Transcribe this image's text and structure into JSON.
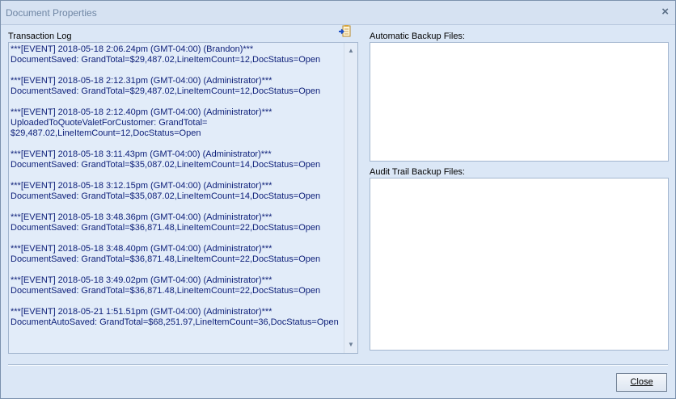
{
  "window": {
    "title": "Document Properties",
    "close_glyph": "×"
  },
  "transaction_log": {
    "label": "Transaction Log",
    "export_icon": "export-to-document-icon",
    "entries": [
      "***[EVENT] 2018-05-18 2:06.24pm (GMT-04:00) (Brandon)***\nDocumentSaved: GrandTotal=$29,487.02,LineItemCount=12,DocStatus=Open",
      "***[EVENT] 2018-05-18 2:12.31pm (GMT-04:00) (Administrator)***\nDocumentSaved: GrandTotal=$29,487.02,LineItemCount=12,DocStatus=Open",
      "***[EVENT] 2018-05-18 2:12.40pm (GMT-04:00) (Administrator)***\nUploadedToQuoteValetForCustomer: GrandTotal=\n$29,487.02,LineItemCount=12,DocStatus=Open",
      "***[EVENT] 2018-05-18 3:11.43pm (GMT-04:00) (Administrator)***\nDocumentSaved: GrandTotal=$35,087.02,LineItemCount=14,DocStatus=Open",
      "***[EVENT] 2018-05-18 3:12.15pm (GMT-04:00) (Administrator)***\nDocumentSaved: GrandTotal=$35,087.02,LineItemCount=14,DocStatus=Open",
      "***[EVENT] 2018-05-18 3:48.36pm (GMT-04:00) (Administrator)***\nDocumentSaved: GrandTotal=$36,871.48,LineItemCount=22,DocStatus=Open",
      "***[EVENT] 2018-05-18 3:48.40pm (GMT-04:00) (Administrator)***\nDocumentSaved: GrandTotal=$36,871.48,LineItemCount=22,DocStatus=Open",
      "***[EVENT] 2018-05-18 3:49.02pm (GMT-04:00) (Administrator)***\nDocumentSaved: GrandTotal=$36,871.48,LineItemCount=22,DocStatus=Open",
      "***[EVENT] 2018-05-21 1:51.51pm (GMT-04:00) (Administrator)***\nDocumentAutoSaved: GrandTotal=$68,251.97,LineItemCount=36,DocStatus=Open"
    ]
  },
  "automatic_backup": {
    "label": "Automatic Backup Files:"
  },
  "audit_trail_backup": {
    "label": "Audit Trail Backup Files:"
  },
  "footer": {
    "close_label": "Close"
  },
  "colors": {
    "log_text": "#0c1e78",
    "window_bg": "#dbe7f6"
  }
}
